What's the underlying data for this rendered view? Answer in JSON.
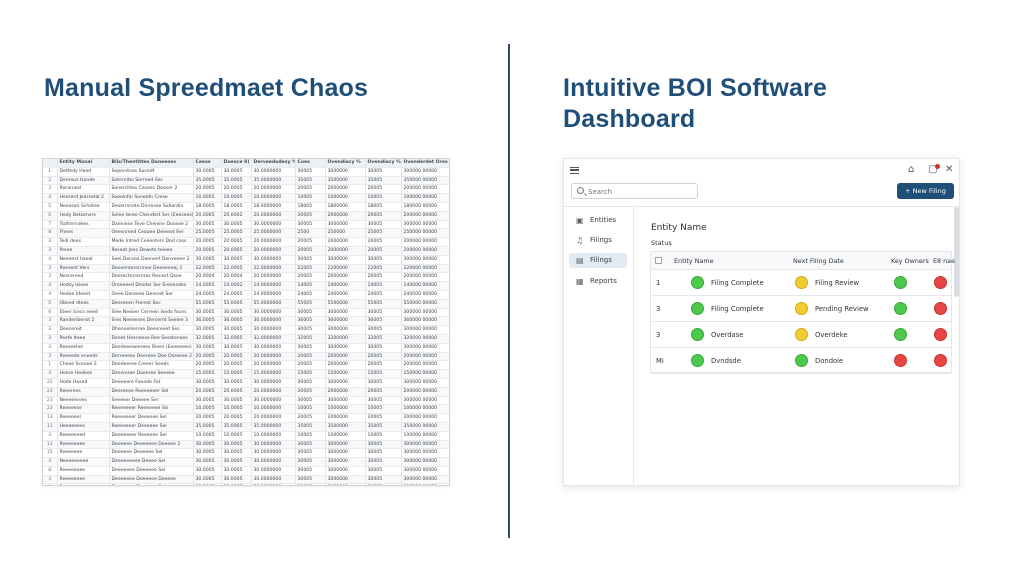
{
  "headings": {
    "left": "Manual Spreedmaet Chaos",
    "right": "Intuitive BOI Software Dashboard"
  },
  "spreadsheet": {
    "columns": [
      "",
      "Entity Manal",
      "Blis/Thentittes Doneeses",
      "Ceess",
      "Doeoce 8)",
      "Derveedodesy %",
      "Coes",
      "Ovendiocy %",
      "Ovendiocy %",
      "Ovenderdet Ores"
    ],
    "rows": [
      [
        "1",
        "Detfedy Haed",
        "Seperstnes Socedt",
        "30.0005",
        "30.0005",
        "30.0000000",
        "30005",
        "3000000",
        "30005",
        "300000 00000"
      ],
      [
        "2",
        "Deerous Hande",
        "Saternitei Serrned Sec",
        "35.0005",
        "35.0005",
        "35.0000000",
        "35005",
        "3500000",
        "35005",
        "350000 00000"
      ],
      [
        "3",
        "Rerarnsel",
        "Senerchtes Casees Doecer 2",
        "20.0005",
        "20.0005",
        "20.0000000",
        "20005",
        "2000000",
        "20005",
        "200000 00000"
      ],
      [
        "4",
        "Hesserd Jearsetal 2",
        "Sooeinfoi Soneotn Crese",
        "10.0005",
        "10.0005",
        "10.0000000",
        "10005",
        "1000000",
        "10005",
        "100000 00000"
      ],
      [
        "5",
        "Neeesan Schotee",
        "Deserrsnete Dinresee Sohordia",
        "18.0005",
        "18.0005",
        "18.0000000",
        "18005",
        "1800000",
        "18005",
        "180000 00000"
      ],
      [
        "6",
        "Hedy Betseners",
        "Selee teree Chendert Ser (Eeesees)",
        "20.0005",
        "20.0002",
        "20.0000000",
        "20005",
        "2000000",
        "20005",
        "200000 00000"
      ],
      [
        "7",
        "Tsofrerndees",
        "Daeniese Teve Cheiene Doosee 2",
        "30.0005",
        "30.0005",
        "30.0000000",
        "30005",
        "3000000",
        "30005",
        "300000 00000"
      ],
      [
        "8",
        "Fhees",
        "Oeesnreed Ceaoee Deieeet Ser",
        "25.0005",
        "25.0005",
        "25.0000000",
        "2500",
        "250000",
        "25005",
        "250000 00000"
      ],
      [
        "3",
        "Tedi dees",
        "Mede Intred Ceeenters Dod coss",
        "20.0005",
        "20.0005",
        "20.0000000",
        "20005",
        "2000000",
        "20005",
        "200000 00000"
      ],
      [
        "3",
        "Poree",
        "Reseat Jees Dewste teieee",
        "20.0005",
        "20.0005",
        "20.0000000",
        "20005",
        "2000000",
        "20005",
        "200000 00000"
      ],
      [
        "4",
        "Neeeest haeel",
        "Seei Derone Doeneef Denveeee 2",
        "30.0005",
        "30.0005",
        "30.0000000",
        "30005",
        "3000000",
        "30005",
        "300000 00000"
      ],
      [
        "3",
        "Reesent Vers",
        "Deesenterorrineo Deeeeeeaj 3",
        "22.0005",
        "22.0005",
        "22.0000000",
        "22005",
        "2200000",
        "22005",
        "220000 00000"
      ],
      [
        "3",
        "Nesrerned",
        "Deerectnrrernres Resrert Dsoe",
        "20.0004",
        "20.0004",
        "20.0000000",
        "20005",
        "2000000",
        "20005",
        "200000 00000"
      ],
      [
        "4",
        "Hodsy Isiees",
        "Oroeeeed Desder Ser Ereensdes",
        "14.0005",
        "14.0002",
        "14.0000000",
        "14005",
        "1400000",
        "14005",
        "140000 00000"
      ],
      [
        "4",
        "Hedee Ideeet",
        "Oeee Deroeee Deesret Ser",
        "24.0005",
        "24.0005",
        "24.0000000",
        "24005",
        "2400000",
        "24005",
        "240000 00000"
      ],
      [
        "5",
        "Obeed dtees",
        "Deereeen Frerest Sec",
        "55.0005",
        "55.0005",
        "55.0000000",
        "55005",
        "5500000",
        "55005",
        "550000 00000"
      ],
      [
        "6",
        "Eteer Icecs eeed",
        "Slee Neeoer Cerreen Isedo foces",
        "30.0005",
        "30.0005",
        "30.0000000",
        "30005",
        "3000000",
        "30005",
        "300000 00000"
      ],
      [
        "3",
        "Randeribenst 2",
        "Sres Neeeeses Derseret Seelee 3",
        "36.0005",
        "36.0005",
        "36.0000000",
        "36005",
        "3600000",
        "36005",
        "360000 00000"
      ],
      [
        "3",
        "Deecereit",
        "Dhenoelserree Deesreeet Ses",
        "30.0005",
        "30.0005",
        "30.0000000",
        "30005",
        "3000000",
        "30005",
        "300000 00000"
      ],
      [
        "3",
        "Peefe Iteee",
        "Deeet Heeneese Ree Sesetenoes",
        "32.0005",
        "32.0005",
        "32.0000000",
        "32005",
        "3200000",
        "32005",
        "320000 00000"
      ],
      [
        "3",
        "Reeseelee",
        "Deedeeeaeerees Riees (Eeeeeees)",
        "30.0005",
        "30.0005",
        "30.0000000",
        "30005",
        "3000000",
        "30005",
        "300000 00000"
      ],
      [
        "3",
        "Reeeede eneeds",
        "Derreeees Deereee Doe Dereeee 2",
        "20.0005",
        "20.0005",
        "20.0000000",
        "20005",
        "2000000",
        "20005",
        "200000 00000"
      ],
      [
        "1",
        "Cheoe Scenee 2",
        "Deedeeree Creeer Seeds",
        "20.0005",
        "20.0005",
        "20.0000000",
        "20005",
        "2000000",
        "20005",
        "200000 00000"
      ],
      [
        "3",
        "Hosse Hedees",
        "Deesreree Doeeree Seeeee",
        "15.0005",
        "15.0005",
        "15.0000000",
        "15005",
        "1500000",
        "15005",
        "150000 00000"
      ],
      [
        "22",
        "Hode Hesed",
        "Deeeeere Foeede Fet",
        "30.0005",
        "30.0005",
        "30.0000000",
        "30005",
        "3000000",
        "30005",
        "300000 00000"
      ],
      [
        "23",
        "Reeerees",
        "Deereeee Reeeeeeer Sel",
        "20.0005",
        "20.0005",
        "20.0000000",
        "20005",
        "2000000",
        "20005",
        "200000 00000"
      ],
      [
        "23",
        "Neeeeerees",
        "Seeeeer Deeeee Ser",
        "30.0005",
        "30.0005",
        "30.0000000",
        "30005",
        "3000000",
        "30005",
        "300000 00000"
      ],
      [
        "23",
        "Reeeeese",
        "Reeeeeeer Reeeeeee Sis",
        "10.0005",
        "10.0005",
        "10.0000000",
        "10005",
        "1000000",
        "10005",
        "100000 00000"
      ],
      [
        "13",
        "Reeeeeel",
        "Reeeeeeer Deeeeee Sel",
        "20.0005",
        "20.0005",
        "20.0000000",
        "20005",
        "2000000",
        "20005",
        "200000 00000"
      ],
      [
        "11",
        "Heeeeeees",
        "Reeeeeeer Deeeeee Sel",
        "35.0005",
        "35.0005",
        "35.0000000",
        "35005",
        "3500000",
        "35005",
        "350000 00000"
      ],
      [
        "3",
        "Reeeeeeed",
        "Deeeeeeer Reeeeee Sel",
        "10.0005",
        "10.0005",
        "10.0000000",
        "10005",
        "1000000",
        "10005",
        "100000 00000"
      ],
      [
        "13",
        "Reeeeeeee",
        "Deeeeee Deeeeeee Deeeee 2",
        "30.0005",
        "30.0005",
        "30.0000000",
        "30005",
        "3000000",
        "30005",
        "300000 00000"
      ],
      [
        "15",
        "Reeeeeee",
        "Deeeeee Deeeeee Sel",
        "30.0005",
        "30.0005",
        "30.0000000",
        "30005",
        "3000000",
        "30005",
        "300000 00000"
      ],
      [
        "3",
        "Neeeeeeeee",
        "Deeeeeeeee Deeee Sel",
        "30.0005",
        "30.0005",
        "30.0000000",
        "30005",
        "3000000",
        "30005",
        "300000 00000"
      ],
      [
        "8",
        "Reeeeeeee",
        "Deeeeeee Deeeeee Sel",
        "30.0005",
        "30.0005",
        "30.0000000",
        "30005",
        "3000000",
        "30005",
        "300000 00000"
      ],
      [
        "3",
        "Reeeeeeee",
        "Deeeeeee Deeeeee Deeeee",
        "30.0005",
        "30.0005",
        "30.0000000",
        "30005",
        "3000000",
        "30005",
        "300000 00000"
      ],
      [
        "3",
        "Reeeeeeee",
        "Deeeeeee Deeeeee Sel",
        "30.0005",
        "30.0005",
        "30.0000000",
        "30005",
        "3000000",
        "30005",
        "300000 00000"
      ],
      [
        "3",
        "Reeeeeeee",
        "Deeeeeee Deeeeee Deeeee",
        "30.0005",
        "30.0005",
        "30.0000000",
        "30005",
        "3000000",
        "30005",
        "300000 00000"
      ],
      [
        "3",
        "Reeeeeeee",
        "Deeeeeee Deeeeee Deeeee",
        "30.0005",
        "30.0005",
        "30.0000000",
        "30005",
        "3000000",
        "30005",
        "300000 00000"
      ],
      [
        "3",
        "Reeeeeeee",
        "Deeeeeee Deeeeee Deeeee",
        "30.0005",
        "30.0005",
        "30.0000000",
        "30005",
        "3000000",
        "30005",
        "300000 00000"
      ]
    ]
  },
  "dashboard": {
    "search_placeholder": "Search",
    "new_filing_label": "+ New Filing",
    "sidebar": [
      {
        "icon": "▤",
        "label": "Entities",
        "active": false
      },
      {
        "icon": "🔔",
        "label": "Filings",
        "active": false
      },
      {
        "icon": "▤",
        "label": "Filings",
        "active": true
      },
      {
        "icon": "▤",
        "label": "Reports",
        "active": false
      }
    ],
    "title": "Entity Name",
    "subtitle": "Status",
    "columns": {
      "name": "Entity Name",
      "date": "Next Filing Date",
      "owners": "Key Owners",
      "bn": "E8 nae"
    },
    "rows": [
      {
        "num": "1",
        "status_color": "green",
        "status": "Filing Complete",
        "next_color": "yellow",
        "next": "Filing Review",
        "owners_color": "green",
        "bn_color": "red"
      },
      {
        "num": "3",
        "status_color": "green",
        "status": "Filing Complete",
        "next_color": "yellow",
        "next": "Pending Review",
        "owners_color": "green",
        "bn_color": "red"
      },
      {
        "num": "3",
        "status_color": "green",
        "status": "Overdase",
        "next_color": "yellow",
        "next": "Overdeke",
        "owners_color": "green",
        "bn_color": "red"
      },
      {
        "num": "Mi",
        "status_color": "green",
        "status": "Dvndsde",
        "next_color": "green",
        "next": "Dondoie",
        "owners_color": "red",
        "bn_color": "red"
      }
    ]
  }
}
